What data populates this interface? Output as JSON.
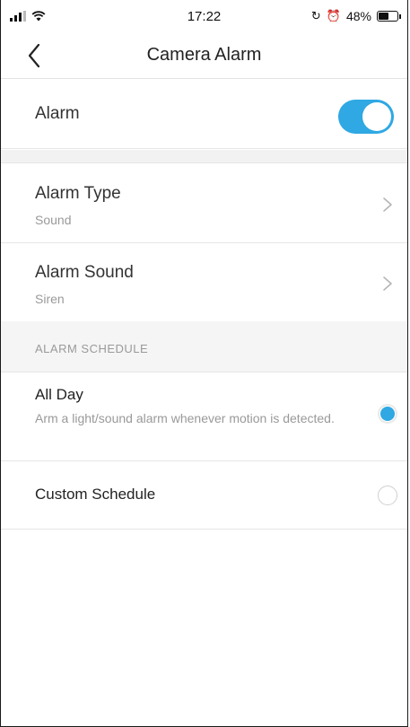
{
  "status_bar": {
    "time": "17:22",
    "battery_percent_label": "48%",
    "battery_level": 0.48,
    "icons": [
      "signal-icon",
      "wifi-icon",
      "orientation-lock-icon",
      "alarm-clock-icon",
      "battery-icon"
    ]
  },
  "nav": {
    "title": "Camera Alarm",
    "back_icon": "chevron-left-icon"
  },
  "alarm": {
    "label": "Alarm",
    "enabled": true
  },
  "settings": [
    {
      "title": "Alarm Type",
      "value": "Sound"
    },
    {
      "title": "Alarm Sound",
      "value": "Siren"
    }
  ],
  "schedule": {
    "header": "ALARM SCHEDULE",
    "options": [
      {
        "title": "All Day",
        "description": "Arm a light/sound alarm whenever motion is detected.",
        "selected": true
      },
      {
        "title": "Custom Schedule",
        "selected": false
      }
    ]
  },
  "colors": {
    "accent": "#2fa8e3",
    "divider": "#e6e6e6",
    "secondary_text": "#999999",
    "section_background": "#f5f5f5"
  }
}
